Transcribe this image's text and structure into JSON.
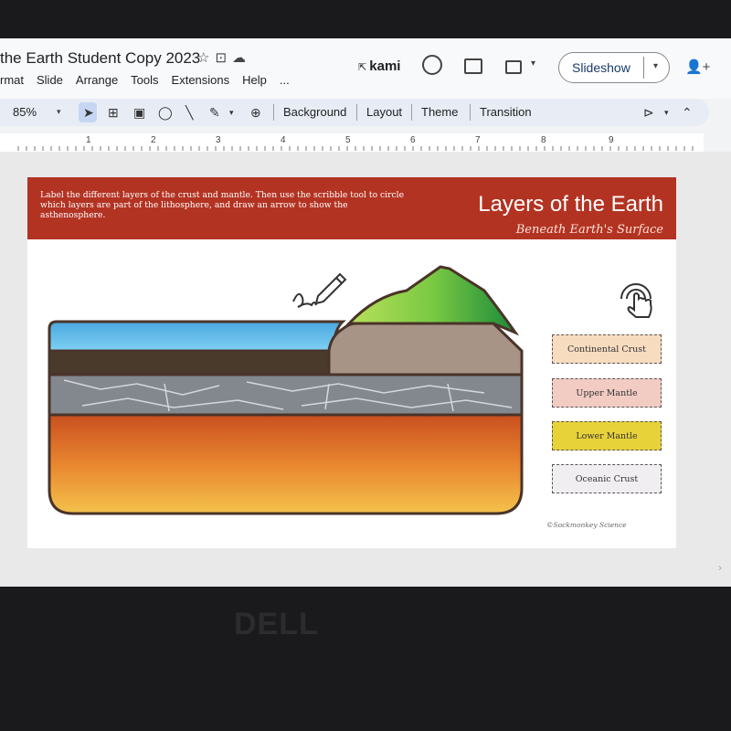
{
  "app": {
    "doc_title": "the Earth Student Copy 2023",
    "menus": [
      "rmat",
      "Slide",
      "Arrange",
      "Tools",
      "Extensions",
      "Help",
      "..."
    ],
    "kami_label": "kami",
    "slideshow_label": "Slideshow"
  },
  "toolbar": {
    "zoom": "85%",
    "buttons": [
      "Background",
      "Layout",
      "Theme",
      "Transition"
    ]
  },
  "ruler": {
    "marks": [
      "1",
      "2",
      "3",
      "4",
      "5",
      "6",
      "7",
      "8",
      "9"
    ]
  },
  "slide": {
    "instructions": "Label the different layers of the crust and mantle. Then use the scribble tool to circle which layers are part of the lithosphere, and draw an arrow to show the asthenosphere.",
    "title": "Layers of the Earth",
    "subtitle": "Beneath Earth's Surface",
    "labels": [
      {
        "text": "Continental Crust",
        "color": "#f8dcc0"
      },
      {
        "text": "Upper Mantle",
        "color": "#f2cbc3"
      },
      {
        "text": "Lower Mantle",
        "color": "#e8d23a"
      },
      {
        "text": "Oceanic Crust",
        "color": "#f1eef2"
      }
    ],
    "credit": "©Sockmonkey Science"
  },
  "device": {
    "brand": "DELL"
  },
  "colors": {
    "banner": "#b33322",
    "ocean": "#41a6de",
    "mountain": "#7ac943",
    "continental_crust": "#a79487",
    "mantle_lithosphere": "#7f848e",
    "lower_mantle": "#e07a2a"
  }
}
